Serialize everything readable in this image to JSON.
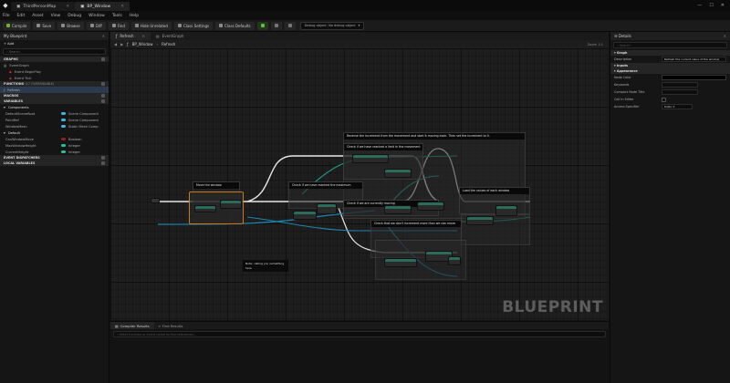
{
  "titlebar": {
    "tabs": [
      {
        "label": "ThirdPersonMap",
        "active": false
      },
      {
        "label": "BP_Window",
        "active": true
      }
    ]
  },
  "menubar": {
    "items": [
      "File",
      "Edit",
      "Asset",
      "View",
      "Debug",
      "Window",
      "Tools",
      "Help"
    ]
  },
  "toolbar": {
    "compile": "Compile",
    "save": "Save",
    "browse": "Browse",
    "diff": "Diff",
    "find": "Find",
    "hide_unrelated": "Hide Unrelated",
    "class_settings": "Class Settings",
    "class_defaults": "Class Defaults",
    "debug_object": "Debug object: No debug object"
  },
  "left_panel": {
    "tab": "My Blueprint",
    "add_label": "Add",
    "search_placeholder": "Search",
    "graphs_header": "GRAPHS",
    "graph_items": [
      "EventGraph",
      "Event BeginPlay",
      "Event Tick"
    ],
    "functions_header": "FUNCTIONS",
    "functions_note": "(17 OVERRIDABLE)",
    "function_items": [
      "Refresh"
    ],
    "macros_header": "MACROS",
    "variables_header": "VARIABLES",
    "variable_groups": [
      {
        "name": "Components",
        "items": [
          {
            "name": "DefaultSceneRoot",
            "type": "Scene Component",
            "color": "#3fb6e0"
          },
          {
            "name": "PointRef",
            "type": "Scene Component",
            "color": "#3fb6e0"
          },
          {
            "name": "WindowMesh",
            "type": "Static Mesh Comp",
            "color": "#3fb6e0"
          }
        ]
      },
      {
        "name": "Default",
        "items": [
          {
            "name": "CanWindowMove",
            "type": "Boolean",
            "color": "#9a1d1d"
          },
          {
            "name": "MaxWindowHeight",
            "type": "Integer",
            "color": "#22c29a"
          },
          {
            "name": "CurrentHeight",
            "type": "Integer",
            "color": "#22c29a"
          }
        ]
      }
    ],
    "dispatchers_header": "EVENT DISPATCHERS",
    "local_header": "LOCAL VARIABLES"
  },
  "graph": {
    "tabs": [
      {
        "label": "Refresh",
        "active": true
      },
      {
        "label": "EventGraph",
        "active": false
      }
    ],
    "breadcrumb": [
      "BP_Window",
      "Refresh"
    ],
    "zoom": "Zoom 1:1",
    "comments": [
      "Move the window",
      "Reverse the increment from the movement and start it moving back. Then set the increment to 0.",
      "Check if we have reached a limit in the movement",
      "Check if we have reached the maximum",
      "Load the values of each window",
      "Check that we don't increment more than we can move",
      "Check if we are currently moving"
    ],
    "note": "Note: calling you something here",
    "watermark": "BLUEPRINT"
  },
  "bottom": {
    "tabs": [
      "Compiler Results",
      "Find Results"
    ],
    "search_placeholder": "Enter function or event name to find references..."
  },
  "details": {
    "tab": "Details",
    "search_placeholder": "Search",
    "sections": [
      {
        "title": "Graph",
        "rows": [
          {
            "label": "Description",
            "value": "Refresh the current value of the window"
          }
        ]
      },
      {
        "title": "Inputs",
        "rows": []
      },
      {
        "title": "Appearance",
        "rows": [
          {
            "label": "Node Color",
            "value": ""
          },
          {
            "label": "Keywords",
            "value": ""
          },
          {
            "label": "Compact Node Title",
            "value": ""
          },
          {
            "label": "Call In Editor",
            "value": ""
          },
          {
            "label": "Access Specifier",
            "value": "Public"
          }
        ]
      }
    ]
  }
}
